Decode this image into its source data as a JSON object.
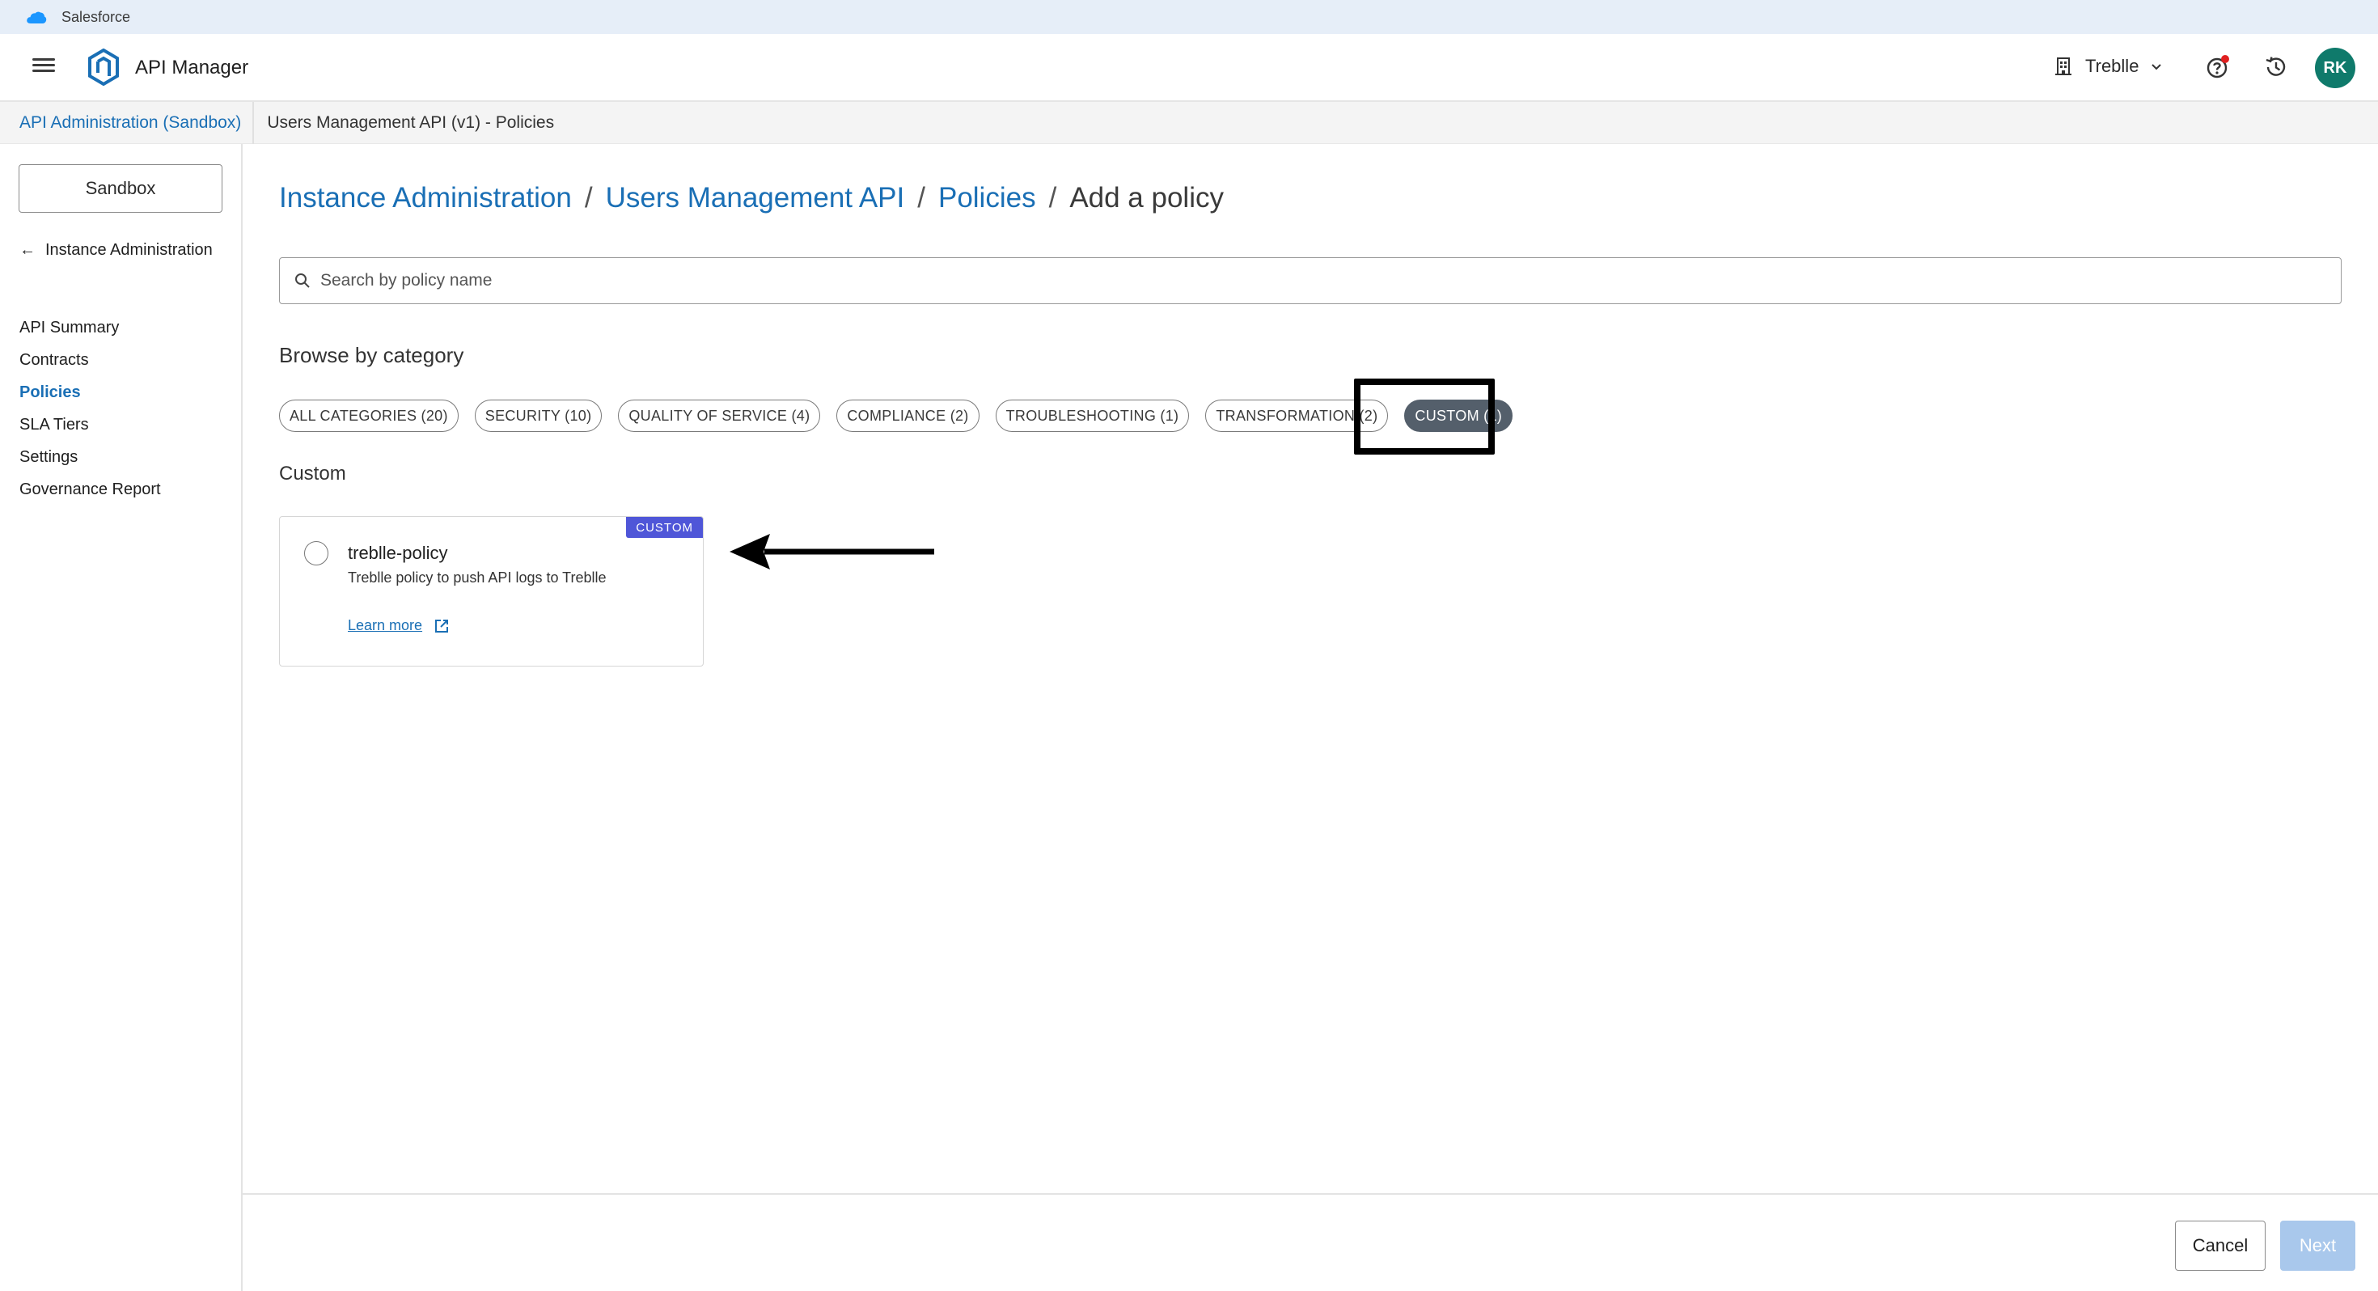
{
  "topbar": {
    "label": "Salesforce"
  },
  "header": {
    "app_title": "API Manager",
    "org_name": "Treblle",
    "avatar_initials": "RK"
  },
  "breadcrumb": {
    "parent": "API Administration (Sandbox)",
    "current": "Users Management API (v1) - Policies"
  },
  "sidebar": {
    "env_button": "Sandbox",
    "back_link": "Instance Administration",
    "items": [
      {
        "label": "API Summary"
      },
      {
        "label": "Contracts"
      },
      {
        "label": "Policies"
      },
      {
        "label": "SLA Tiers"
      },
      {
        "label": "Settings"
      },
      {
        "label": "Governance Report"
      }
    ]
  },
  "main": {
    "heading": {
      "crumb1": "Instance Administration",
      "crumb2": "Users Management API",
      "crumb3": "Policies",
      "current": "Add a policy",
      "separator": "/"
    },
    "search_placeholder": "Search by policy name",
    "browse_title": "Browse by category",
    "categories": [
      {
        "label": "ALL CATEGORIES (20)"
      },
      {
        "label": "SECURITY (10)"
      },
      {
        "label": "QUALITY OF SERVICE (4)"
      },
      {
        "label": "COMPLIANCE (2)"
      },
      {
        "label": "TROUBLESHOOTING (1)"
      },
      {
        "label": "TRANSFORMATION (2)"
      },
      {
        "label": "CUSTOM (1)"
      }
    ],
    "section_title": "Custom",
    "policy_card": {
      "badge": "CUSTOM",
      "name": "treblle-policy",
      "description": "Treblle policy to push API logs to Treblle",
      "learn_more": "Learn more"
    }
  },
  "footer": {
    "cancel_label": "Cancel",
    "next_label": "Next"
  },
  "colors": {
    "link": "#1a6fb5",
    "active_chip": "#545f6b",
    "badge": "#4f56d8",
    "avatar": "#0f7a6b",
    "next_disabled": "#a9c8ec"
  }
}
